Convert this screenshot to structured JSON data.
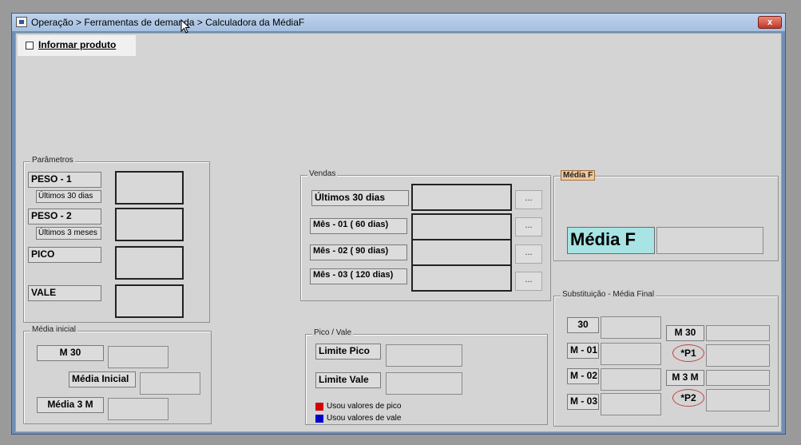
{
  "window": {
    "title": "Operação > Ferramentas de demanda > Calculadora da MédiaF",
    "close_label": "x"
  },
  "informar_produto": {
    "label": "Informar produto",
    "checked": false
  },
  "parametros": {
    "legend": "Parâmetros",
    "peso1": "PESO - 1",
    "peso1_sub": "Últimos 30 dias",
    "peso2": "PESO - 2",
    "peso2_sub": "Últimos 3 meses",
    "pico": "PICO",
    "vale": "VALE"
  },
  "media_inicial": {
    "legend": "Média inicial",
    "m30": "M 30",
    "media_inicial": "Média Inicial",
    "media_3m": "Média 3 M"
  },
  "vendas": {
    "legend": "Vendas",
    "ultimos30": "Últimos 30 dias",
    "mes01": "Mês - 01 ( 60 dias)",
    "mes02": "Mês - 02 ( 90 dias)",
    "mes03": "Mês - 03 ( 120 dias)",
    "dots": "..."
  },
  "pico_vale": {
    "legend": "Pico / Vale",
    "limite_pico": "Limite Pico",
    "limite_vale": "Limite Vale",
    "legend_pico": "Usou valores de pico",
    "legend_vale": "Usou valores de vale",
    "color_pico": "#d40000",
    "color_vale": "#0000cc"
  },
  "media_f": {
    "legend": "Média F",
    "label": "Média F",
    "label_bg": "#a8e4e4"
  },
  "substituicao": {
    "legend": "Substituição - Média Final",
    "l30": "30",
    "m01": "M - 01",
    "m02": "M - 02",
    "m03": "M - 03",
    "m30": "M 30",
    "p1": "*P1",
    "m3m": "M 3 M",
    "p2": "*P2"
  }
}
